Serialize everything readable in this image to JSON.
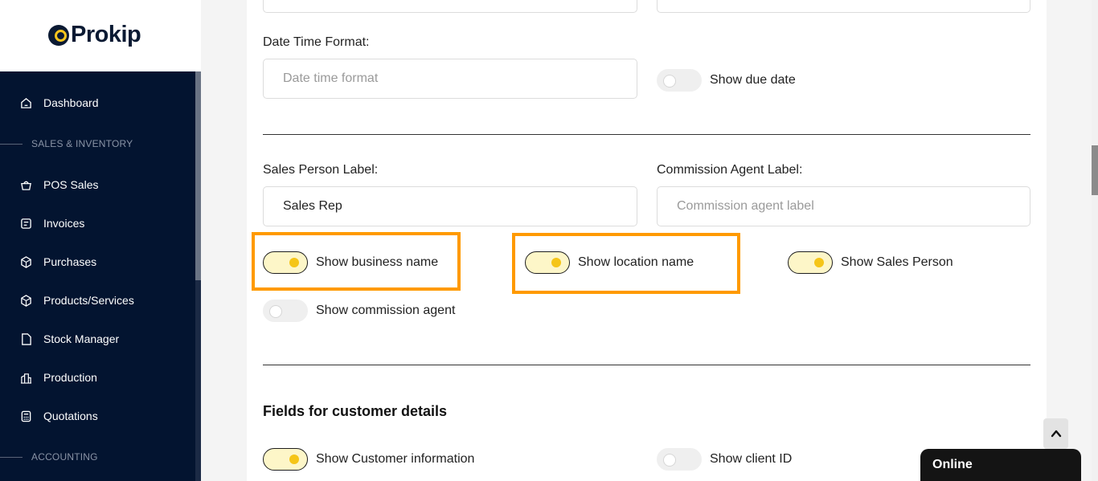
{
  "brand": {
    "name": "Prokip"
  },
  "sidebar": {
    "items": [
      {
        "label": "Dashboard",
        "icon": "home-icon"
      },
      {
        "label": "POS Sales",
        "icon": "basket-icon"
      },
      {
        "label": "Invoices",
        "icon": "invoice-icon"
      },
      {
        "label": "Purchases",
        "icon": "box-icon"
      },
      {
        "label": "Products/Services",
        "icon": "cube-icon"
      },
      {
        "label": "Stock Manager",
        "icon": "stock-icon"
      },
      {
        "label": "Production",
        "icon": "factory-icon"
      },
      {
        "label": "Quotations",
        "icon": "calculator-icon"
      }
    ],
    "sections": {
      "sales_inventory": "SALES & INVENTORY",
      "accounting": "ACCOUNTING"
    }
  },
  "form": {
    "date_time_format": {
      "label": "Date Time Format:",
      "placeholder": "Date time format"
    },
    "show_due_date": {
      "label": "Show due date",
      "on": false
    },
    "sales_person_label": {
      "label": "Sales Person Label:",
      "value": "Sales Rep"
    },
    "commission_agent_label": {
      "label": "Commission Agent Label:",
      "placeholder": "Commission agent label"
    },
    "toggles": {
      "business_name": {
        "label": "Show business name",
        "on": true
      },
      "location_name": {
        "label": "Show location name",
        "on": true
      },
      "sales_person": {
        "label": "Show Sales Person",
        "on": true
      },
      "commission_agent": {
        "label": "Show commission agent",
        "on": false
      }
    },
    "customer_section": {
      "heading": "Fields for customer details",
      "customer_information": {
        "label": "Show Customer information",
        "on": true
      },
      "client_id": {
        "label": "Show client ID",
        "on": false
      }
    }
  },
  "chat": {
    "status": "Online"
  },
  "colors": {
    "sidebar_bg": "#031430",
    "accent": "#f5c518",
    "highlight": "#ff9a00"
  }
}
